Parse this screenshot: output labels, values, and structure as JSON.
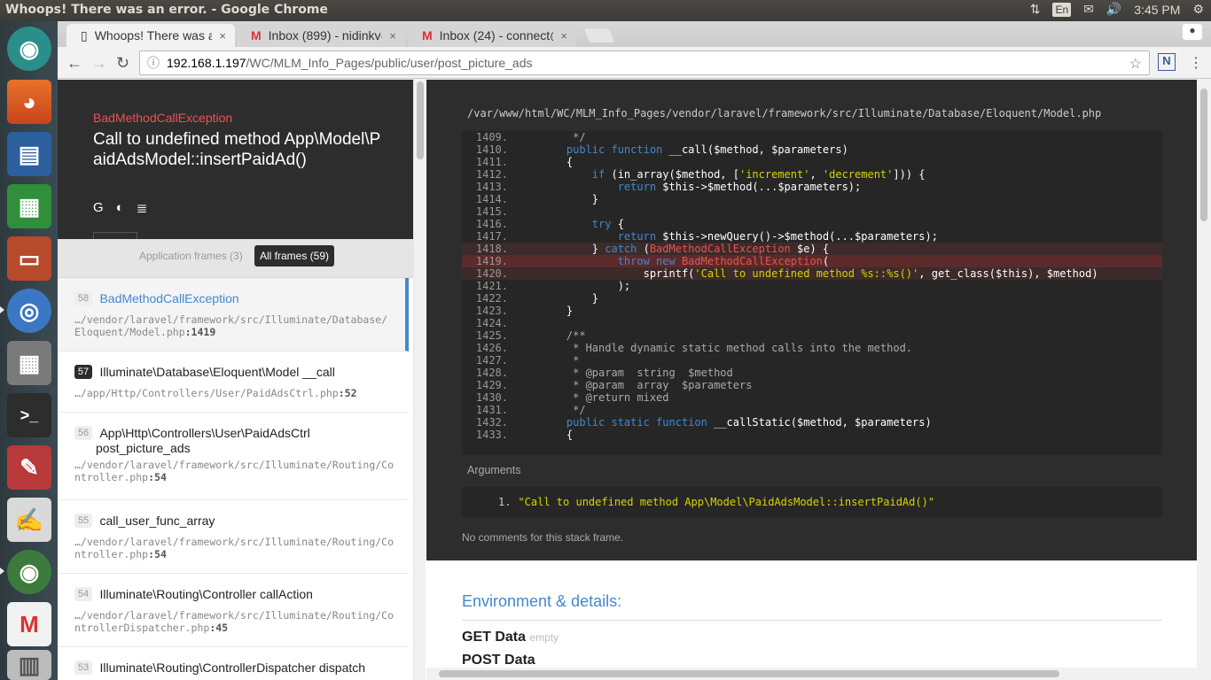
{
  "window": {
    "title": "Whoops! There was an error. - Google Chrome"
  },
  "tray": {
    "language": "En",
    "time": "3:45 PM"
  },
  "tabs": [
    {
      "title": "Whoops! There was an error.",
      "close": "×"
    },
    {
      "title": "Inbox (899) - nidinkv@gmail.com",
      "close": "×"
    },
    {
      "title": "Inbox (24) - connect@example.com",
      "close": "×"
    }
  ],
  "omnibox": {
    "host": "192.168.1.197",
    "path": "/WC/MLM_Info_Pages/public/user/post_picture_ads"
  },
  "extension": {
    "label": "N"
  },
  "exception": {
    "name": "BadMethodCallException",
    "message": "Call to undefined method App\\Model\\PaidAdsModel::insertPaidAd()"
  },
  "filters": {
    "application": "Application frames (3)",
    "all": "All frames (59)"
  },
  "frames": [
    {
      "num": "58",
      "cls": "BadMethodCallException",
      "method": "",
      "file": "…/vendor/laravel/framework/src/Illuminate/Database/Eloquent/Model.php",
      "line": ":1419"
    },
    {
      "num": "57",
      "cls": "Illuminate\\Database\\Eloquent\\Model __call",
      "method": "",
      "file": "…/app/Http/Controllers/User/PaidAdsCtrl.php",
      "line": ":52"
    },
    {
      "num": "56",
      "cls": "App\\Http\\Controllers\\User\\PaidAdsCtrl",
      "method": "post_picture_ads",
      "file": "…/vendor/laravel/framework/src/Illuminate/Routing/Controller.php",
      "line": ":54"
    },
    {
      "num": "55",
      "cls": "call_user_func_array",
      "method": "",
      "file": "…/vendor/laravel/framework/src/Illuminate/Routing/Controller.php",
      "line": ":54"
    },
    {
      "num": "54",
      "cls": "Illuminate\\Routing\\Controller callAction",
      "method": "",
      "file": "…/vendor/laravel/framework/src/Illuminate/Routing/ControllerDispatcher.php",
      "line": ":45"
    },
    {
      "num": "53",
      "cls": "Illuminate\\Routing\\ControllerDispatcher dispatch",
      "method": "",
      "file": "",
      "line": ""
    }
  ],
  "code": {
    "path": "/var/www/html/WC/MLM_Info_Pages/vendor/laravel/framework/src/Illuminate/Database/Eloquent/Model.php",
    "lines": [
      {
        "n": "1409.",
        "html": "<span class=\"cm\">     */</span>"
      },
      {
        "n": "1410.",
        "html": "    <span class=\"kw\">public function</span> __call($method, $parameters)"
      },
      {
        "n": "1411.",
        "html": "    {"
      },
      {
        "n": "1412.",
        "html": "        <span class=\"kw\">if</span> (in_array($method, [<span class=\"str\">'increment'</span>, <span class=\"str\">'decrement'</span>])) {"
      },
      {
        "n": "1413.",
        "html": "            <span class=\"kw\">return</span> $this->$method(...$parameters);"
      },
      {
        "n": "1414.",
        "html": "        }"
      },
      {
        "n": "1415.",
        "html": ""
      },
      {
        "n": "1416.",
        "html": "        <span class=\"kw\">try</span> {"
      },
      {
        "n": "1417.",
        "html": "            <span class=\"kw\">return</span> $this->newQuery()->$method(...$parameters);"
      },
      {
        "n": "1418.",
        "html": "        } <span class=\"kw\">catch</span> (<span class=\"exc\">BadMethodCallException</span> $e) {",
        "hl": "hl"
      },
      {
        "n": "1419.",
        "html": "            <span class=\"kw\">throw new</span> <span class=\"exc\">BadMethodCallException</span>(",
        "hl": "hl2"
      },
      {
        "n": "1420.",
        "html": "                sprintf(<span class=\"str\">'Call to undefined method %s::%s()'</span>, get_class($this), $method)",
        "hl": "hl"
      },
      {
        "n": "1421.",
        "html": "            );"
      },
      {
        "n": "1422.",
        "html": "        }"
      },
      {
        "n": "1423.",
        "html": "    }"
      },
      {
        "n": "1424.",
        "html": ""
      },
      {
        "n": "1425.",
        "html": "<span class=\"cm\">    /**</span>"
      },
      {
        "n": "1426.",
        "html": "<span class=\"cm\">     * Handle dynamic static method calls into the method.</span>"
      },
      {
        "n": "1427.",
        "html": "<span class=\"cm\">     *</span>"
      },
      {
        "n": "1428.",
        "html": "<span class=\"cm\">     * @param  string  $method</span>"
      },
      {
        "n": "1429.",
        "html": "<span class=\"cm\">     * @param  array  $parameters</span>"
      },
      {
        "n": "1430.",
        "html": "<span class=\"cm\">     * @return mixed</span>"
      },
      {
        "n": "1431.",
        "html": "<span class=\"cm\">     */</span>"
      },
      {
        "n": "1432.",
        "html": "    <span class=\"kw\">public static function</span> __callStatic($method, $parameters)"
      },
      {
        "n": "1433.",
        "html": "    {"
      }
    ]
  },
  "arguments": {
    "label": "Arguments",
    "index": "1.",
    "value": "\"Call to undefined method App\\Model\\PaidAdsModel::insertPaidAd()\""
  },
  "comments": "No comments for this stack frame.",
  "environment": {
    "heading": "Environment & details:",
    "get": "GET Data",
    "get_note": "empty",
    "post": "POST Data"
  }
}
